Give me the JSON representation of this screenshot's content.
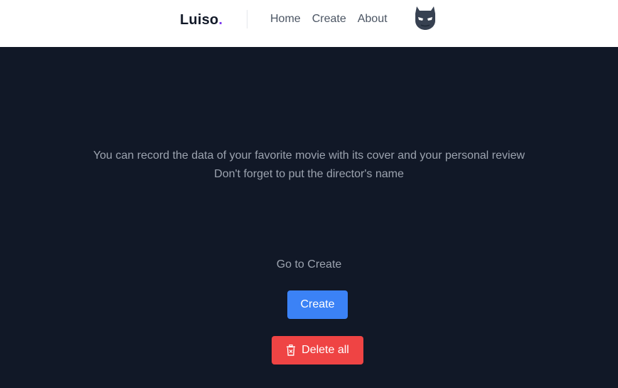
{
  "header": {
    "brand": "Luiso",
    "brand_dot": ".",
    "nav": [
      "Home",
      "Create",
      "About"
    ],
    "avatar_icon": "batman-mask-icon"
  },
  "main": {
    "intro_line1": "You can record the data of your favorite movie with its cover and your personal review",
    "intro_line2": "Don't forget to put the director's name",
    "goto_label": "Go to Create",
    "create_label": "Create",
    "delete_label": "Delete all",
    "delete_icon": "trash-icon"
  },
  "colors": {
    "background": "#111827",
    "navbar": "#ffffff",
    "brand_accent": "#7c3aed",
    "primary": "#3b82f6",
    "danger": "#ef4444",
    "muted_text": "#9ca3af"
  }
}
